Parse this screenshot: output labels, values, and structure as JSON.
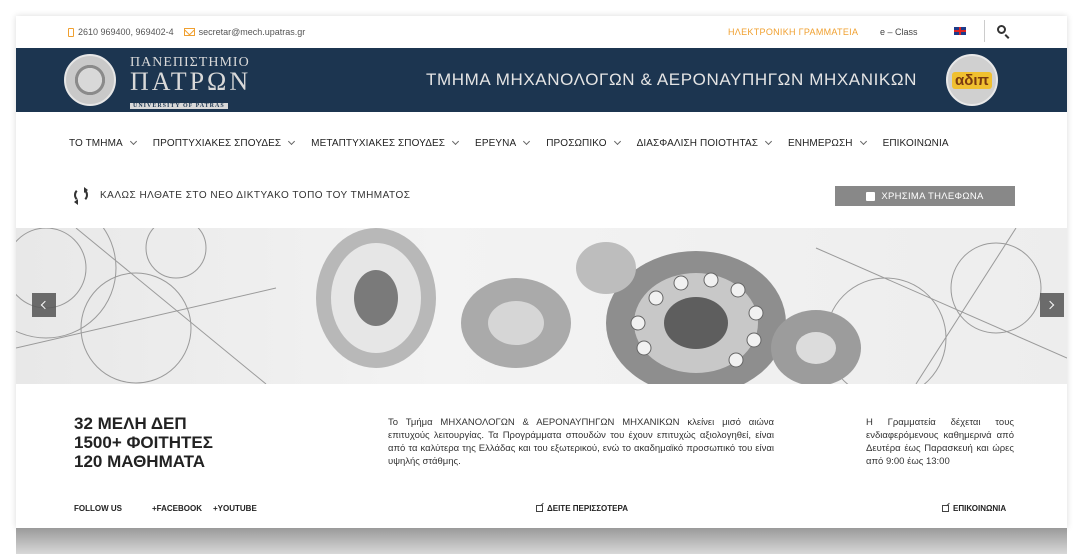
{
  "topbar": {
    "phone": "2610 969400, 969402-4",
    "email": "secretar@mech.upatras.gr",
    "secretariat": "ΗΛΕΚΤΡΟΝΙΚΗ ΓΡΑΜΜΑΤΕΙΑ",
    "eclass": "e – Class"
  },
  "header": {
    "logo_line1": "ΠΑΝΕΠΙΣΤΗΜΙΟ",
    "logo_line2": "ΠΑΤΡΩΝ",
    "logo_line3": "UNIVERSITY OF PATRAS",
    "title": "ΤΜΗΜΑ ΜΗΧΑΝΟΛΟΓΩΝ & ΑΕΡΟΝΑΥΠΗΓΩΝ ΜΗΧΑΝΙΚΩΝ",
    "badge_text": "αδιπ"
  },
  "nav": {
    "items": [
      {
        "label": "ΤΟ ΤΜΗΜΑ"
      },
      {
        "label": "ΠΡΟΠΤΥΧΙΑΚΕΣ ΣΠΟΥΔΕΣ"
      },
      {
        "label": "ΜΕΤΑΠΤΥΧΙΑΚΕΣ ΣΠΟΥΔΕΣ"
      },
      {
        "label": "ΕΡΕΥΝΑ"
      },
      {
        "label": "ΠΡΟΣΩΠΙΚΟ"
      },
      {
        "label": "ΔΙΑΣΦΑΛΙΣΗ ΠΟΙΟΤΗΤΑΣ"
      },
      {
        "label": "ΕΝΗΜΕΡΩΣΗ"
      },
      {
        "label": "ΕΠΙΚΟΙΝΩΝΙΑ"
      }
    ]
  },
  "welcome": {
    "text": "ΚΑΛΩΣ ΗΛΘΑΤΕ ΣΤΟ ΝΕΟ ΔΙΚΤΥΑΚΟ ΤΟΠΟ ΤΟΥ ΤΜΗΜΑΤΟΣ",
    "phones_button": "ΧΡΗΣΙΜΑ ΤΗΛΕΦΩΝΑ"
  },
  "info": {
    "stat1": "32 ΜΕΛΗ ΔΕΠ",
    "stat2": "1500+ ΦΟΙΤΗΤΕΣ",
    "stat3": "120 ΜΑΘΗΜΑΤΑ",
    "about": "Το Τμήμα ΜΗΧΑΝΟΛΟΓΩΝ & ΑΕΡΟΝΑΥΠΗΓΩΝ ΜΗΧΑΝΙΚΩΝ κλείνει μισό αιώνα επιτυχούς λειτουργίας. Τα Προγράμματα σπουδών του έχουν επιτυχώς αξιολογηθεί, είναι από τα καλύτερα της Ελλάδας και του εξωτερικού, ενώ το ακαδημαϊκό προσωπικό του είναι υψηλής στάθμης.",
    "hours": "Η Γραμματεία δέχεται τους ενδιαφερόμενους καθημερινά από Δευτέρα έως Παρασκευή και ώρες από 9:00 έως 13:00"
  },
  "footer": {
    "follow": "FOLLOW US",
    "facebook": "+FACEBOOK",
    "youtube": "+YOUTUBE",
    "more": "ΔΕΙΤΕ ΠΕΡΙΣΣΟΤΕΡΑ",
    "contact": "ΕΠΙΚΟΙΝΩΝΙΑ"
  },
  "colors": {
    "header_bg": "#1c3550",
    "accent_orange": "#f0a030",
    "button_gray": "#888888"
  }
}
